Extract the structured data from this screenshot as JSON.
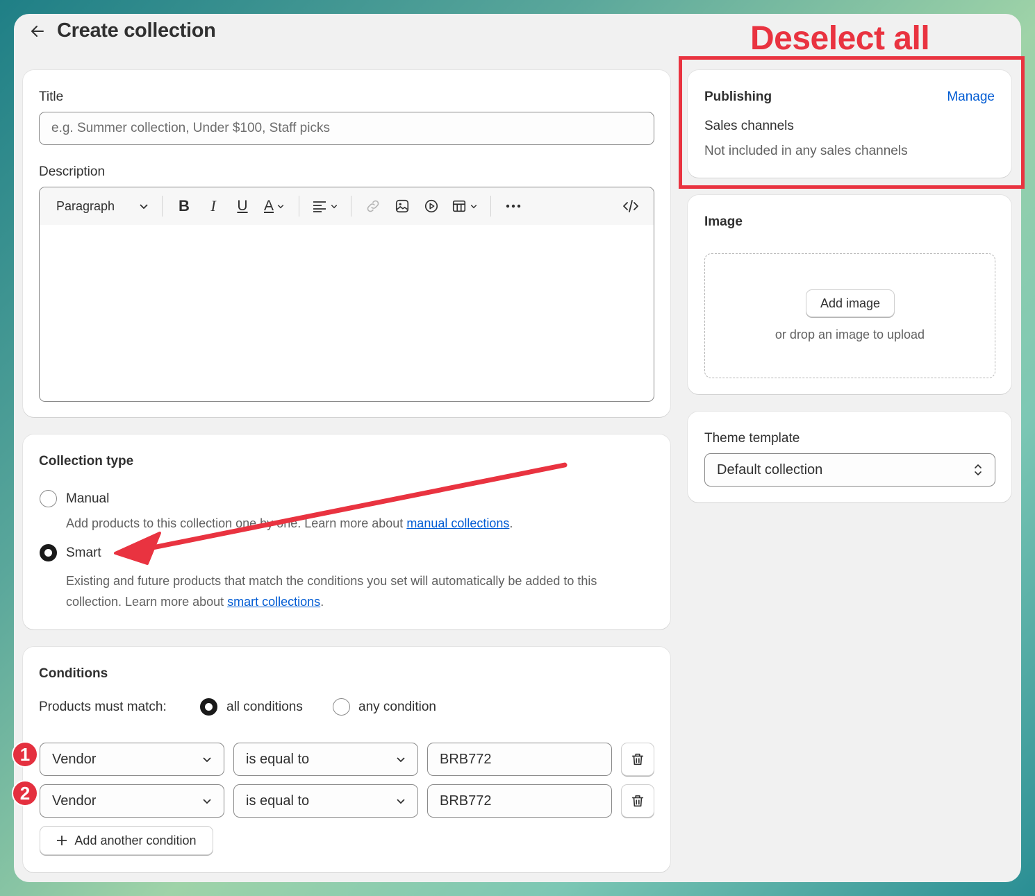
{
  "page": {
    "title": "Create collection"
  },
  "main": {
    "title_label": "Title",
    "title_placeholder": "e.g. Summer collection, Under $100, Staff picks",
    "description_label": "Description",
    "toolbar": {
      "paragraph_label": "Paragraph"
    }
  },
  "collection_type": {
    "heading": "Collection type",
    "manual_label": "Manual",
    "manual_help_prefix": "Add products to this collection one by one. Learn more about ",
    "manual_link": "manual collections",
    "manual_help_suffix": ".",
    "manual_selected": false,
    "smart_label": "Smart",
    "smart_help_line1": "Existing and future products that match the conditions you set will automatically be added to this",
    "smart_help_prefix": "collection. Learn more about ",
    "smart_link": "smart collections",
    "smart_help_suffix": ".",
    "smart_selected": true
  },
  "conditions": {
    "heading": "Conditions",
    "match_label": "Products must match:",
    "all_label": "all conditions",
    "any_label": "any condition",
    "match_selected": "all conditions",
    "rows": [
      {
        "badge": "1",
        "field": "Vendor",
        "operator": "is equal to",
        "value": "BRB772"
      },
      {
        "badge": "2",
        "field": "Vendor",
        "operator": "is equal to",
        "value": "BRB772"
      }
    ],
    "add_button": "Add another condition"
  },
  "publishing": {
    "heading": "Publishing",
    "manage_link": "Manage",
    "channels_label": "Sales channels",
    "channels_status": "Not included in any sales channels"
  },
  "image": {
    "heading": "Image",
    "add_button": "Add image",
    "drop_hint": "or drop an image to upload"
  },
  "theme": {
    "label": "Theme template",
    "selected": "Default collection"
  },
  "annotation": {
    "text": "Deselect all",
    "color": "#e93340"
  }
}
